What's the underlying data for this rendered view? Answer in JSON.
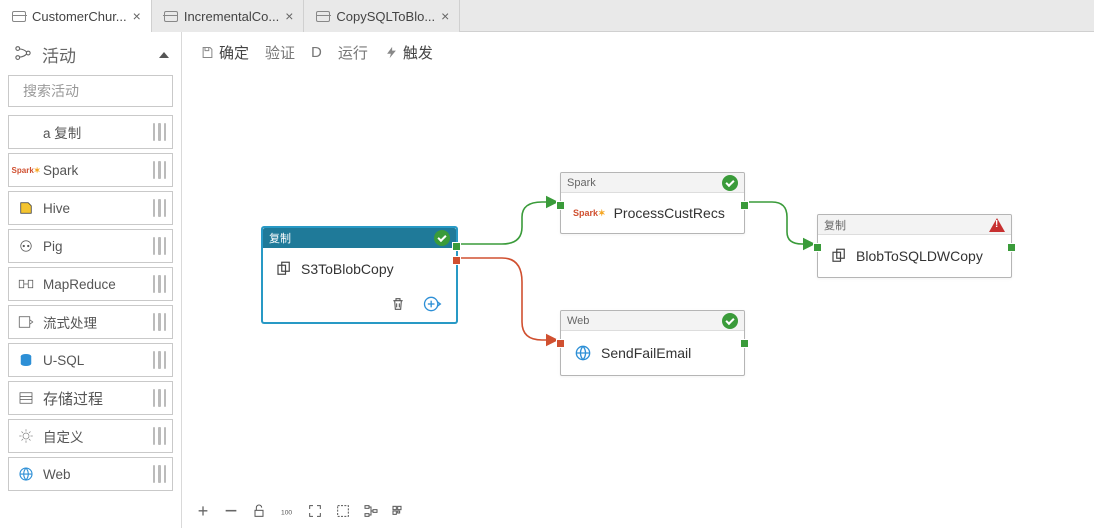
{
  "tabs": [
    {
      "label": "CustomerChur...",
      "active": true
    },
    {
      "label": "IncrementalCo...",
      "active": false
    },
    {
      "label": "CopySQLToBlo...",
      "active": false
    }
  ],
  "sidebar": {
    "title": "活动",
    "search_placeholder": "搜索活动",
    "items": [
      {
        "label": "a 复制",
        "icon": "copy"
      },
      {
        "label": "Spark",
        "icon": "spark"
      },
      {
        "label": "Hive",
        "icon": "hive"
      },
      {
        "label": "Pig",
        "icon": "pig"
      },
      {
        "label": "MapReduce",
        "icon": "mapreduce"
      },
      {
        "label": "流式处理",
        "icon": "stream"
      },
      {
        "label": "U-SQL",
        "icon": "usql"
      },
      {
        "label": "存储过程",
        "icon": "sproc"
      },
      {
        "label": "自定义",
        "icon": "custom"
      },
      {
        "label": "Web",
        "icon": "web"
      }
    ]
  },
  "toolbar": {
    "save": "确定",
    "validate": "验证",
    "debug": "D",
    "run": "运行",
    "trigger": "触发"
  },
  "nodes": {
    "copy": {
      "head": "复制",
      "name": "S3ToBlobCopy",
      "status": "ok",
      "selected": true
    },
    "spark": {
      "head": "Spark",
      "name": "ProcessCustRecs",
      "status": "ok",
      "selected": false
    },
    "web": {
      "head": "Web",
      "name": "SendFailEmail",
      "status": "ok",
      "selected": false
    },
    "copy2": {
      "head": "复制",
      "name": "BlobToSQLDWCopy",
      "status": "warn",
      "selected": false
    }
  },
  "bottombar": [
    "zoom-in",
    "zoom-out",
    "lock",
    "fit",
    "fullscreen",
    "layout",
    "branch",
    "mini"
  ]
}
